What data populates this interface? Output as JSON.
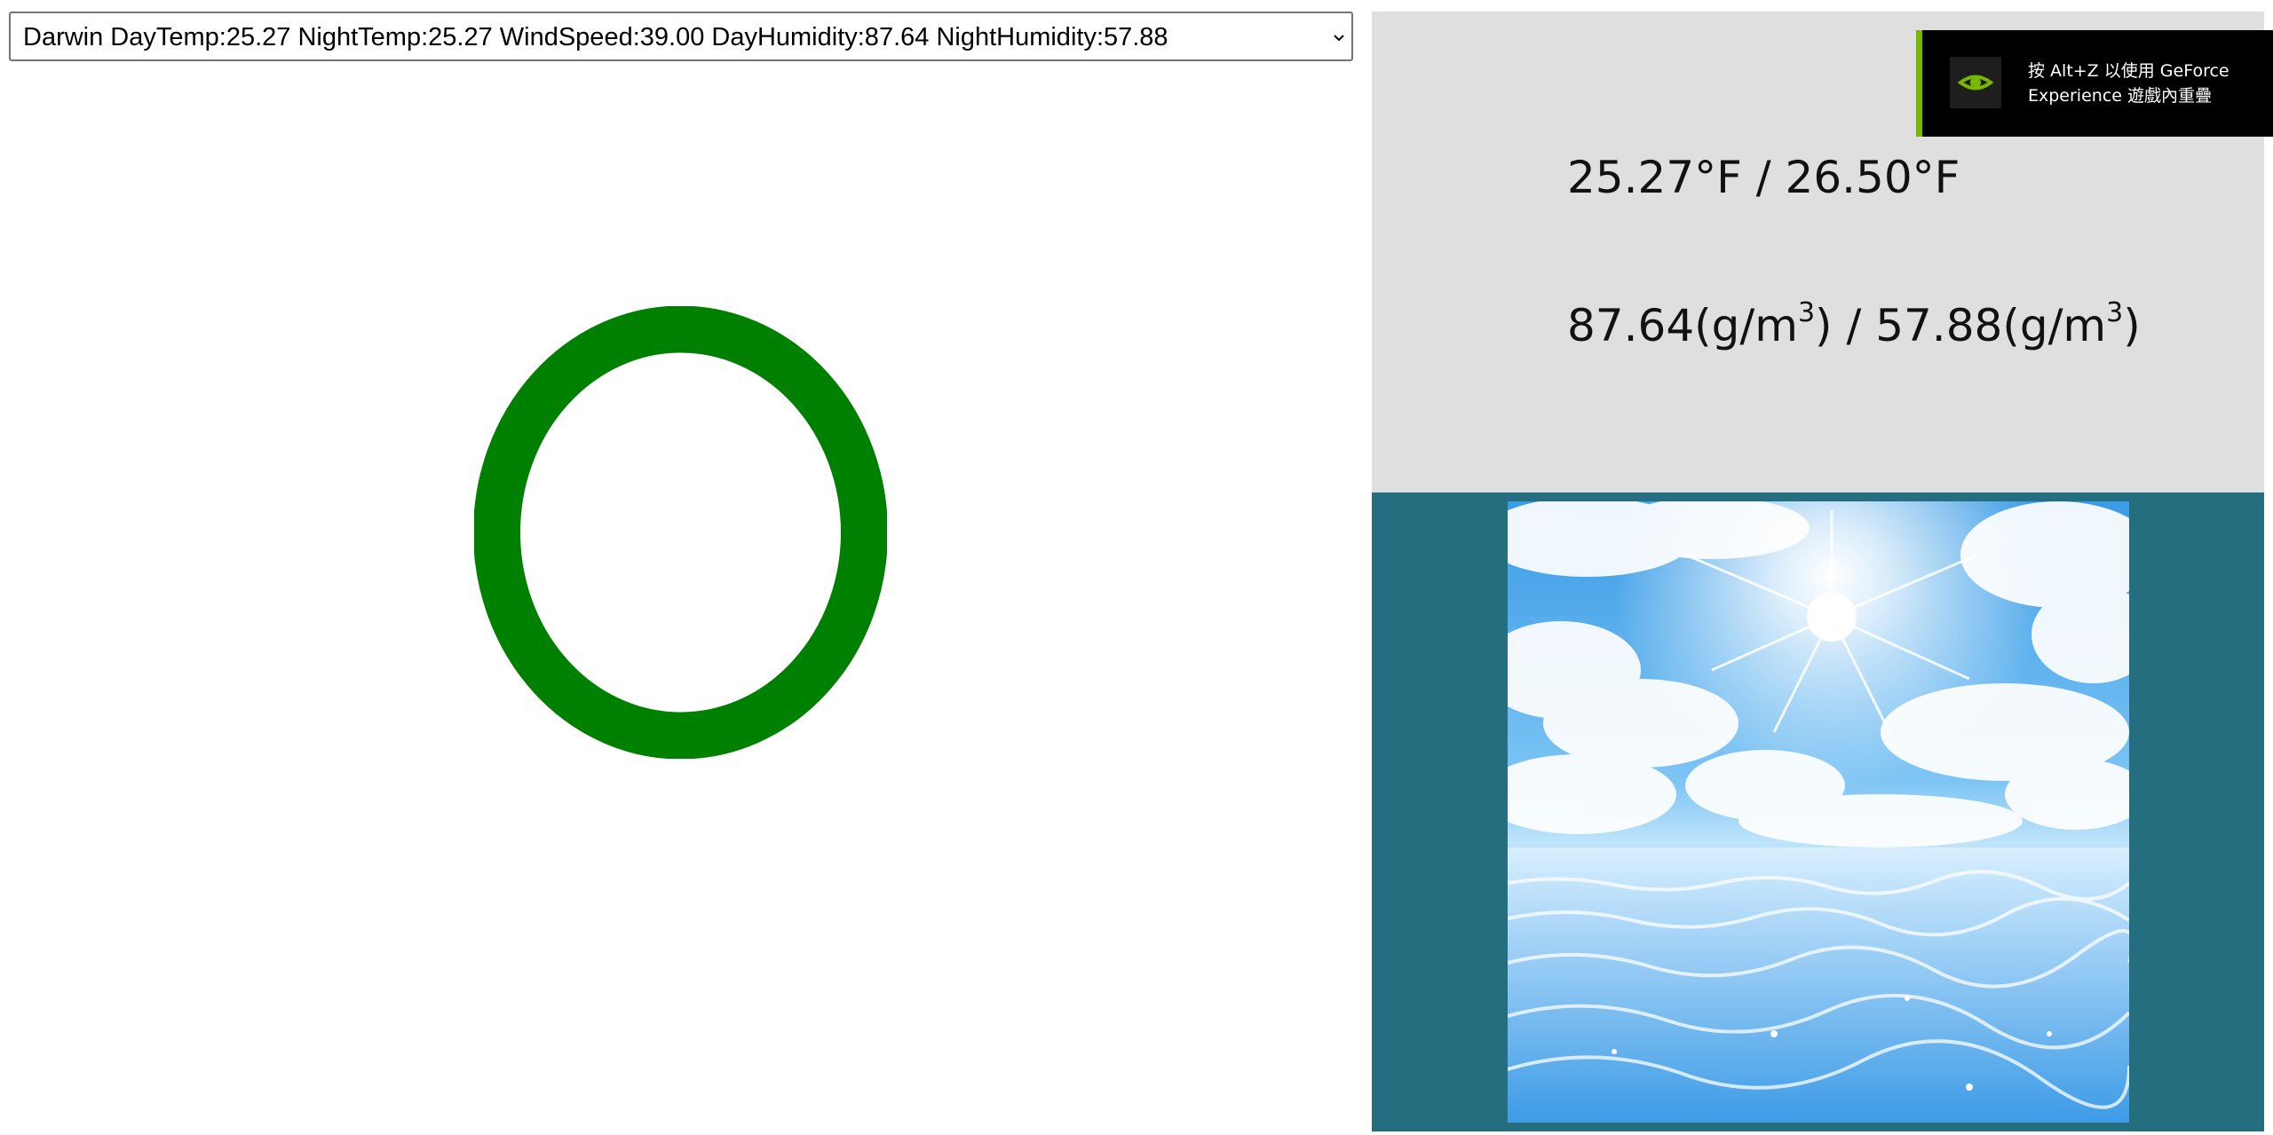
{
  "city_select": {
    "selected_label": "Darwin DayTemp:25.27 NightTemp:25.27 WindSpeed:39.00 DayHumidity:87.64 NightHumidity:57.88"
  },
  "status_indicator": {
    "symbol": "O",
    "color": "#008000"
  },
  "weather_info": {
    "temperature_text": "25.27°F / 26.50°F",
    "humidity": {
      "day_value": "87.64",
      "night_value": "57.88",
      "unit_open": "(g/m",
      "unit_power": "3",
      "unit_close": ")",
      "separator": " / "
    }
  },
  "weather_image": {
    "icon": "sunny-sky-over-water-image"
  },
  "overlay": {
    "line1": "按 Alt+Z 以使用 GeForce",
    "line2": "Experience 遊戲內重疊",
    "icon": "nvidia-icon",
    "accent_color": "#76b900"
  },
  "colors": {
    "panel_gray": "#dfdfdf",
    "panel_teal": "#246e80"
  }
}
